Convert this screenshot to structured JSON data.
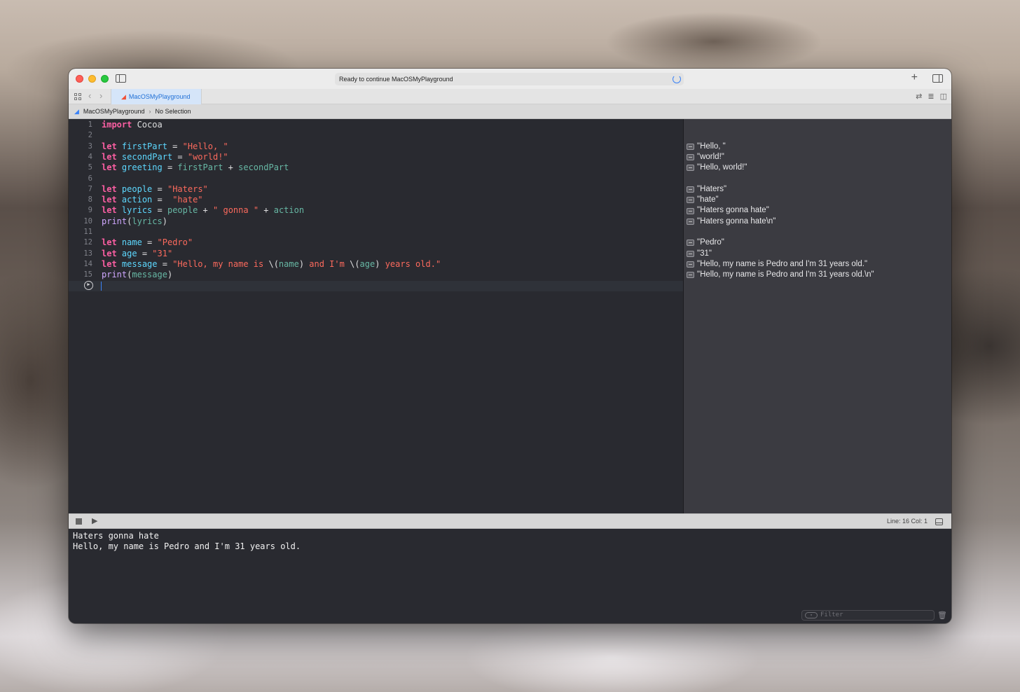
{
  "window": {
    "activity_text": "Ready to continue MacOSMyPlayground",
    "tab_label": "MacOSMyPlayground",
    "breadcrumb": [
      "MacOSMyPlayground",
      "No Selection"
    ]
  },
  "code_lines": [
    {
      "n": "1",
      "tokens": [
        {
          "t": "import",
          "c": "kw"
        },
        {
          "t": " Cocoa",
          "c": "plain"
        }
      ]
    },
    {
      "n": "2",
      "tokens": []
    },
    {
      "n": "3",
      "tokens": [
        {
          "t": "let",
          "c": "kw"
        },
        {
          "t": " ",
          "c": "plain"
        },
        {
          "t": "firstPart",
          "c": "id"
        },
        {
          "t": " = ",
          "c": "plain"
        },
        {
          "t": "\"Hello, \"",
          "c": "str"
        }
      ]
    },
    {
      "n": "4",
      "tokens": [
        {
          "t": "let",
          "c": "kw"
        },
        {
          "t": " ",
          "c": "plain"
        },
        {
          "t": "secondPart",
          "c": "id"
        },
        {
          "t": " = ",
          "c": "plain"
        },
        {
          "t": "\"world!\"",
          "c": "str"
        }
      ]
    },
    {
      "n": "5",
      "tokens": [
        {
          "t": "let",
          "c": "kw"
        },
        {
          "t": " ",
          "c": "plain"
        },
        {
          "t": "greeting",
          "c": "id"
        },
        {
          "t": " = ",
          "c": "plain"
        },
        {
          "t": "firstPart",
          "c": "var"
        },
        {
          "t": " + ",
          "c": "plain"
        },
        {
          "t": "secondPart",
          "c": "var"
        }
      ]
    },
    {
      "n": "6",
      "tokens": []
    },
    {
      "n": "7",
      "tokens": [
        {
          "t": "let",
          "c": "kw"
        },
        {
          "t": " ",
          "c": "plain"
        },
        {
          "t": "people",
          "c": "id"
        },
        {
          "t": " = ",
          "c": "plain"
        },
        {
          "t": "\"Haters\"",
          "c": "str"
        }
      ]
    },
    {
      "n": "8",
      "tokens": [
        {
          "t": "let",
          "c": "kw"
        },
        {
          "t": " ",
          "c": "plain"
        },
        {
          "t": "action",
          "c": "id"
        },
        {
          "t": " =  ",
          "c": "plain"
        },
        {
          "t": "\"hate\"",
          "c": "str"
        }
      ]
    },
    {
      "n": "9",
      "tokens": [
        {
          "t": "let",
          "c": "kw"
        },
        {
          "t": " ",
          "c": "plain"
        },
        {
          "t": "lyrics",
          "c": "id"
        },
        {
          "t": " = ",
          "c": "plain"
        },
        {
          "t": "people",
          "c": "var"
        },
        {
          "t": " + ",
          "c": "plain"
        },
        {
          "t": "\" gonna \"",
          "c": "str"
        },
        {
          "t": " + ",
          "c": "plain"
        },
        {
          "t": "action",
          "c": "var"
        }
      ]
    },
    {
      "n": "10",
      "tokens": [
        {
          "t": "print",
          "c": "fn"
        },
        {
          "t": "(",
          "c": "plain"
        },
        {
          "t": "lyrics",
          "c": "var"
        },
        {
          "t": ")",
          "c": "plain"
        }
      ]
    },
    {
      "n": "11",
      "tokens": []
    },
    {
      "n": "12",
      "tokens": [
        {
          "t": "let",
          "c": "kw"
        },
        {
          "t": " ",
          "c": "plain"
        },
        {
          "t": "name",
          "c": "id"
        },
        {
          "t": " = ",
          "c": "plain"
        },
        {
          "t": "\"Pedro\"",
          "c": "str"
        }
      ]
    },
    {
      "n": "13",
      "tokens": [
        {
          "t": "let",
          "c": "kw"
        },
        {
          "t": " ",
          "c": "plain"
        },
        {
          "t": "age",
          "c": "id"
        },
        {
          "t": " = ",
          "c": "plain"
        },
        {
          "t": "\"31\"",
          "c": "str"
        }
      ]
    },
    {
      "n": "14",
      "tokens": [
        {
          "t": "let",
          "c": "kw"
        },
        {
          "t": " ",
          "c": "plain"
        },
        {
          "t": "message",
          "c": "id"
        },
        {
          "t": " = ",
          "c": "plain"
        },
        {
          "t": "\"Hello, my name is ",
          "c": "str"
        },
        {
          "t": "\\(",
          "c": "plain"
        },
        {
          "t": "name",
          "c": "var"
        },
        {
          "t": ")",
          "c": "plain"
        },
        {
          "t": " and I'm ",
          "c": "str"
        },
        {
          "t": "\\(",
          "c": "plain"
        },
        {
          "t": "age",
          "c": "var"
        },
        {
          "t": ")",
          "c": "plain"
        },
        {
          "t": " years old.\"",
          "c": "str"
        }
      ]
    },
    {
      "n": "15",
      "tokens": [
        {
          "t": "print",
          "c": "fn"
        },
        {
          "t": "(",
          "c": "plain"
        },
        {
          "t": "message",
          "c": "var"
        },
        {
          "t": ")",
          "c": "plain"
        }
      ]
    }
  ],
  "results": [
    {
      "line": 3,
      "text": "\"Hello, \""
    },
    {
      "line": 4,
      "text": "\"world!\""
    },
    {
      "line": 5,
      "text": "\"Hello, world!\""
    },
    {
      "line": 7,
      "text": "\"Haters\""
    },
    {
      "line": 8,
      "text": "\"hate\""
    },
    {
      "line": 9,
      "text": "\"Haters gonna hate\""
    },
    {
      "line": 10,
      "text": "\"Haters gonna hate\\n\""
    },
    {
      "line": 12,
      "text": "\"Pedro\""
    },
    {
      "line": 13,
      "text": "\"31\""
    },
    {
      "line": 14,
      "text": "\"Hello, my name is Pedro and I'm 31 years old.\""
    },
    {
      "line": 15,
      "text": "\"Hello, my name is Pedro and I'm 31 years old.\\n\""
    }
  ],
  "status": {
    "line_col": "Line: 16  Col: 1"
  },
  "console": {
    "lines": [
      "Haters gonna hate",
      "Hello, my name is Pedro and I'm 31 years old."
    ],
    "filter_placeholder": "Filter"
  }
}
